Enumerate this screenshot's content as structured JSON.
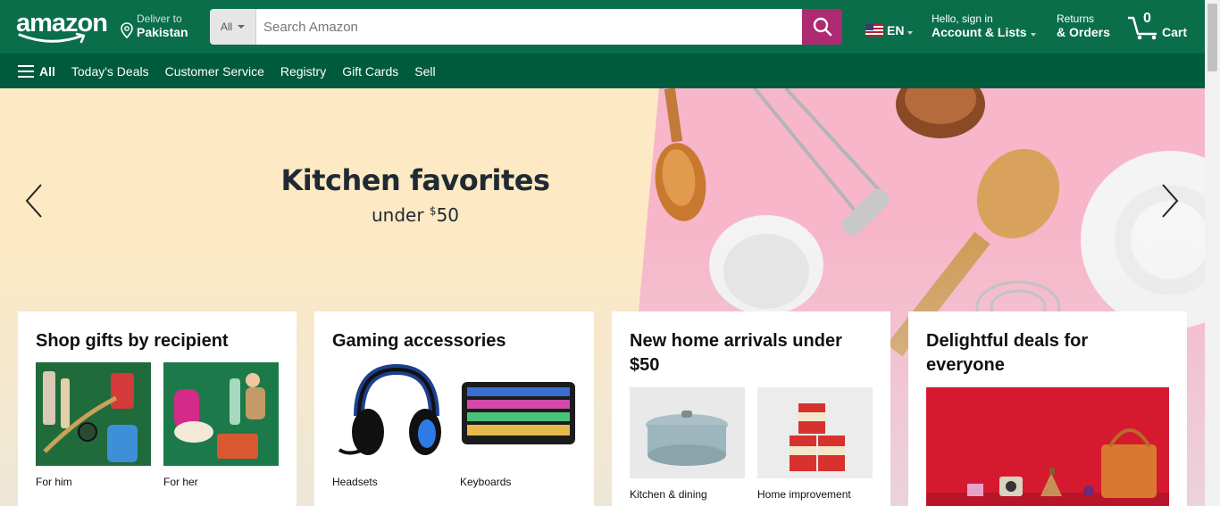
{
  "header": {
    "logo_text": "amazon",
    "deliver": {
      "line1": "Deliver to",
      "line2": "Pakistan"
    },
    "search": {
      "category": "All",
      "placeholder": "Search Amazon"
    },
    "language": "EN",
    "account": {
      "line1": "Hello, sign in",
      "line2": "Account & Lists"
    },
    "returns": {
      "line1": "Returns",
      "line2": "& Orders"
    },
    "cart": {
      "count": "0",
      "label": "Cart"
    }
  },
  "subnav": {
    "all_label": "All",
    "items": [
      "Today's Deals",
      "Customer Service",
      "Registry",
      "Gift Cards",
      "Sell"
    ]
  },
  "hero": {
    "title": "Kitchen favorites",
    "subtitle_prefix": "under ",
    "currency": "$",
    "amount": "50"
  },
  "cards": [
    {
      "title": "Shop gifts by recipient",
      "tiles": [
        "For him",
        "For her"
      ]
    },
    {
      "title": "Gaming accessories",
      "tiles": [
        "Headsets",
        "Keyboards"
      ]
    },
    {
      "title": "New home arrivals under $50",
      "tiles": [
        "Kitchen & dining",
        "Home improvement"
      ]
    },
    {
      "title": "Delightful deals for everyone",
      "tiles": []
    }
  ],
  "colors": {
    "nav_top": "#0a6e4a",
    "nav_sub": "#005a3c",
    "search_button": "#ad2b72",
    "hero_left": "#fde9c3",
    "hero_right": "#f7b6c9"
  }
}
